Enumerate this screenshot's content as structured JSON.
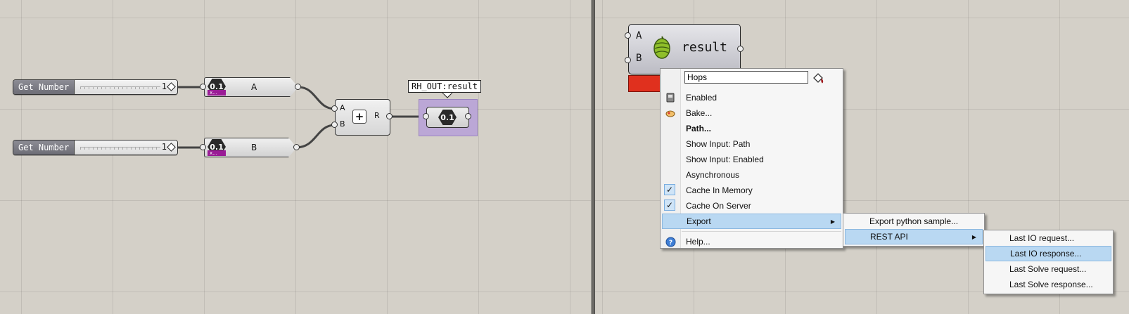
{
  "left": {
    "sliders": [
      {
        "name": "Get Number",
        "value": "1"
      },
      {
        "name": "Get Number",
        "value": "1"
      }
    ],
    "params": [
      {
        "icon_text": "0.1",
        "label": "A",
        "badge": "x..."
      },
      {
        "icon_text": "0.1",
        "label": "B",
        "badge": "x..."
      }
    ],
    "addition": {
      "input_a": "A",
      "input_b": "B",
      "output": "R",
      "symbol": "+"
    },
    "output": {
      "tooltip": "RH_OUT:result",
      "icon_text": "0.1"
    }
  },
  "right": {
    "hops": {
      "input_a": "A",
      "input_b": "B",
      "label": "result",
      "icon": "hops-icon"
    },
    "context_menu": {
      "name_value": "Hops",
      "items": [
        {
          "label": "Enabled",
          "icon": "enabled-icon"
        },
        {
          "label": "Bake...",
          "icon": "bake-icon"
        },
        {
          "label": "Path...",
          "bold": true
        },
        {
          "label": "Show Input: Path"
        },
        {
          "label": "Show Input: Enabled"
        },
        {
          "label": "Asynchronous"
        },
        {
          "label": "Cache In Memory",
          "checked": true
        },
        {
          "label": "Cache On Server",
          "checked": true
        },
        {
          "label": "Export",
          "submenu": true,
          "highlighted": true
        },
        {
          "label": "Help...",
          "icon": "help-icon"
        }
      ]
    },
    "export_menu": {
      "items": [
        {
          "label": "Export python sample..."
        },
        {
          "label": "REST API",
          "submenu": true,
          "highlighted": true
        }
      ]
    },
    "rest_menu": {
      "items": [
        {
          "label": "Last IO request..."
        },
        {
          "label": "Last IO response...",
          "highlighted": true
        },
        {
          "label": "Last Solve request..."
        },
        {
          "label": "Last Solve response..."
        }
      ]
    }
  },
  "colors": {
    "canvas": "#d4d0c8",
    "error": "#e0301e",
    "highlight": "#b9d8f2",
    "selection": "#bba7d6",
    "badge": "#9a1b96"
  }
}
